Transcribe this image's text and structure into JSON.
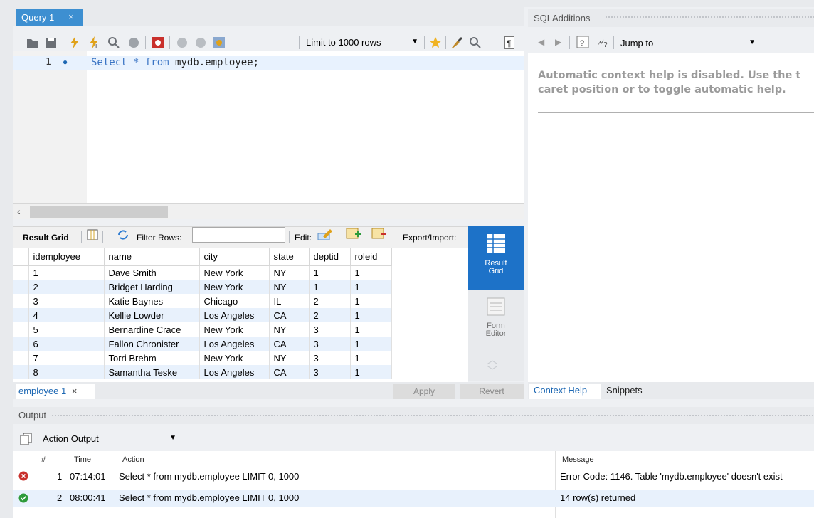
{
  "query_tab": {
    "label": "Query 1",
    "close": "×"
  },
  "toolbar": {
    "limit_label": "Limit to 1000 rows"
  },
  "editor": {
    "line_number": "1",
    "sql_keyword": "Select * from ",
    "sql_object": "mydb.employee",
    "sql_end": ";"
  },
  "result": {
    "result_grid_label": "Result Grid",
    "filter_label": "Filter Rows:",
    "edit_label": "Edit:",
    "export_label": "Export/Import:",
    "columns": [
      "idemployee",
      "name",
      "city",
      "state",
      "deptid",
      "roleid"
    ],
    "rows": [
      [
        "1",
        "Dave Smith",
        "New York",
        "NY",
        "1",
        "1"
      ],
      [
        "2",
        "Bridget Harding",
        "New York",
        "NY",
        "1",
        "1"
      ],
      [
        "3",
        "Katie Baynes",
        "Chicago",
        "IL",
        "2",
        "1"
      ],
      [
        "4",
        "Kellie Lowder",
        "Los Angeles",
        "CA",
        "2",
        "1"
      ],
      [
        "5",
        "Bernardine Crace",
        "New York",
        "NY",
        "3",
        "1"
      ],
      [
        "6",
        "Fallon Chronister",
        "Los Angeles",
        "CA",
        "3",
        "1"
      ],
      [
        "7",
        "Torri Brehm",
        "New York",
        "NY",
        "3",
        "1"
      ],
      [
        "8",
        "Samantha Teske",
        "Los Angeles",
        "CA",
        "3",
        "1"
      ]
    ],
    "side_result_grid": "Result Grid",
    "side_form_editor": "Form Editor",
    "tab_label": "employee 1",
    "tab_close": "×",
    "apply": "Apply",
    "revert": "Revert"
  },
  "sql_additions": {
    "title": "SQLAdditions",
    "jump_to": "Jump to",
    "help_line1": "Automatic context help is disabled. Use the t",
    "help_line2": "caret position or to toggle automatic help.",
    "tab_context_help": "Context Help",
    "tab_snippets": "Snippets"
  },
  "output": {
    "title": "Output",
    "selector": "Action Output",
    "headers": {
      "num": "#",
      "time": "Time",
      "action": "Action",
      "message": "Message"
    },
    "rows": [
      {
        "status": "error",
        "num": "1",
        "time": "07:14:01",
        "action": "Select * from mydb.employee LIMIT 0, 1000",
        "message": "Error Code: 1146. Table 'mydb.employee' doesn't exist"
      },
      {
        "status": "ok",
        "num": "2",
        "time": "08:00:41",
        "action": "Select * from mydb.employee LIMIT 0, 1000",
        "message": "14 row(s) returned"
      }
    ]
  },
  "colors": {
    "accent": "#1d72c8",
    "tab_blue": "#3d8fd1",
    "error": "#c0392b",
    "ok": "#2e9b3a"
  }
}
